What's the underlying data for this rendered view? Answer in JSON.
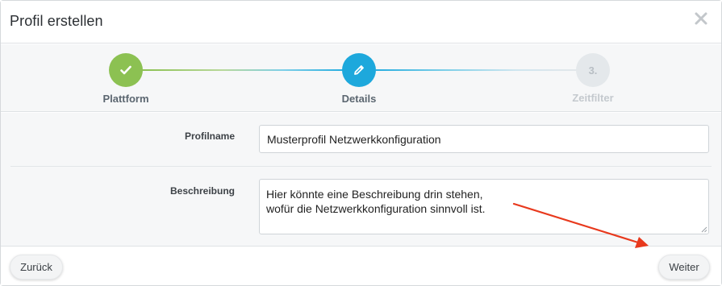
{
  "modal": {
    "title": "Profil erstellen",
    "close_icon": "close-icon"
  },
  "stepper": {
    "steps": [
      {
        "label": "Plattform",
        "state": "completed",
        "icon": "check-icon",
        "color": "#8cc152"
      },
      {
        "label": "Details",
        "state": "active",
        "icon": "pencil-icon",
        "color": "#1da8dc"
      },
      {
        "label": "Zeitfilter",
        "state": "pending",
        "number": "3.",
        "color": "#e4e8eb"
      }
    ]
  },
  "form": {
    "name_label": "Profilname",
    "name_value": "Musterprofil Netzwerkkonfiguration",
    "description_label": "Beschreibung",
    "description_value": "Hier könnte eine Beschreibung drin stehen,\nwofür die Netzwerkkonfiguration sinnvoll ist."
  },
  "footer": {
    "back_label": "Zurück",
    "next_label": "Weiter"
  },
  "annotation": {
    "arrow_color": "#e8391d"
  }
}
